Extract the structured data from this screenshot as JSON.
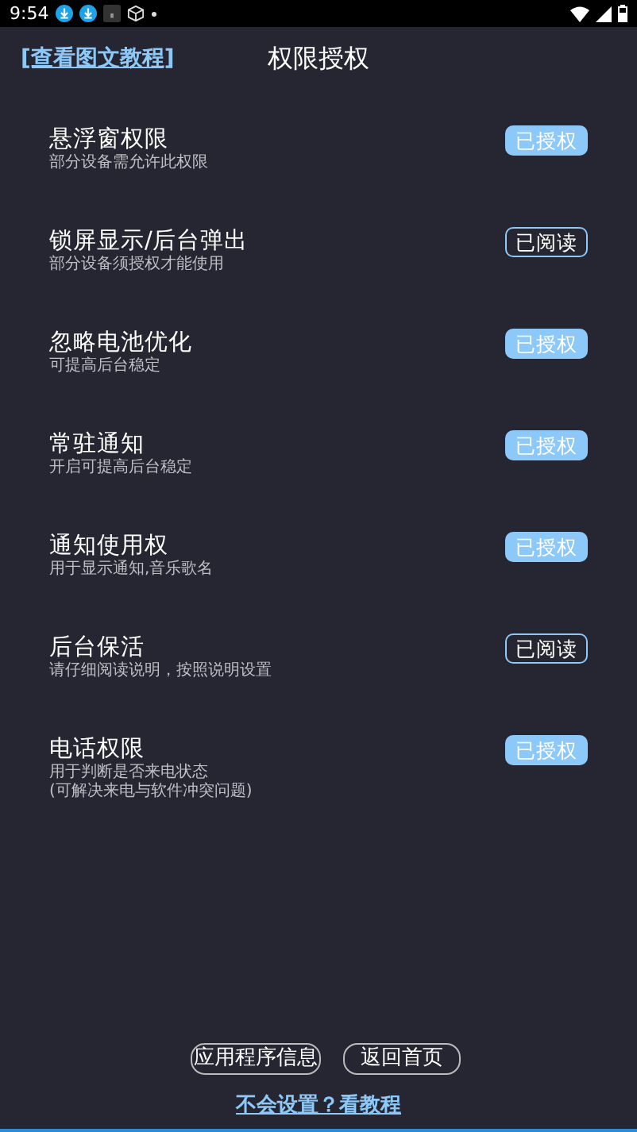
{
  "status_bar": {
    "time": "9:54"
  },
  "header": {
    "tutorial_link": "[查看图文教程]",
    "title": "权限授权"
  },
  "permissions": [
    {
      "title": "悬浮窗权限",
      "subtitle_lines": [
        "部分设备需允许此权限"
      ],
      "badge": {
        "label": "已授权",
        "kind": "granted"
      }
    },
    {
      "title": "锁屏显示/后台弹出",
      "subtitle_lines": [
        "部分设备须授权才能使用"
      ],
      "badge": {
        "label": "已阅读",
        "kind": "read"
      }
    },
    {
      "title": "忽略电池优化",
      "subtitle_lines": [
        "可提高后台稳定"
      ],
      "badge": {
        "label": "已授权",
        "kind": "granted"
      }
    },
    {
      "title": "常驻通知",
      "subtitle_lines": [
        "开启可提高后台稳定"
      ],
      "badge": {
        "label": "已授权",
        "kind": "granted"
      }
    },
    {
      "title": "通知使用权",
      "subtitle_lines": [
        "用于显示通知,音乐歌名"
      ],
      "badge": {
        "label": "已授权",
        "kind": "granted"
      }
    },
    {
      "title": "后台保活",
      "subtitle_lines": [
        "请仔细阅读说明，按照说明设置"
      ],
      "badge": {
        "label": "已阅读",
        "kind": "read"
      }
    },
    {
      "title": "电话权限",
      "subtitle_lines": [
        "用于判断是否来电状态",
        "(可解决来电与软件冲突问题)"
      ],
      "badge": {
        "label": "已授权",
        "kind": "granted"
      }
    }
  ],
  "footer": {
    "buttons": [
      "应用程序信息",
      "返回首页"
    ],
    "help_link": "不会设置？看教程"
  }
}
